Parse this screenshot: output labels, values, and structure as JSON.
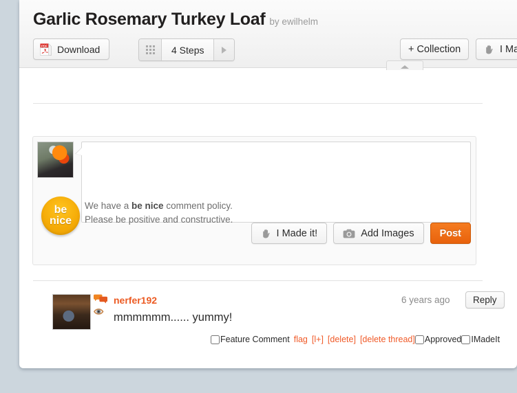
{
  "header": {
    "title": "Garlic Rosemary Turkey Loaf",
    "byline": "by ewilhelm",
    "download_label": "Download",
    "download_icon": "pdf-icon",
    "steps_label": "4 Steps",
    "steps_icon": "grid-icon",
    "steps_next_icon": "play-triangle-icon",
    "collection_label": "+ Collection",
    "made_it_label": "I Made it",
    "made_it_icon": "hand-icon",
    "collapse_tab_icon": "chevron-up-icon"
  },
  "comment_form": {
    "avatar_name": "user-avatar",
    "textarea_value": "",
    "textarea_placeholder": "",
    "benice": {
      "line1": "be",
      "line2": "nice",
      "policy_prefix": "We have a ",
      "policy_bold": "be nice",
      "policy_suffix": " comment policy.",
      "policy_line2": "Please be positive and constructive."
    },
    "made_it_label": "I Made it!",
    "made_it_icon": "hand-icon",
    "add_images_label": "Add Images",
    "add_images_icon": "camera-icon",
    "post_label": "Post"
  },
  "comment": {
    "author": "nerfer192",
    "body": "mmmmmm...... yummy!",
    "time": "6 years ago",
    "reply_label": "Reply",
    "speech_icon": "speech-bubble-icon",
    "eye_icon": "eye-icon",
    "avatar_name": "commenter-avatar",
    "moderation": {
      "feature_label": "Feature Comment",
      "flag_label": "flag",
      "plus_label": "[l+]",
      "delete_label": "[delete]",
      "delete_thread_label": "[delete thread]",
      "approved_label": "Approved",
      "imadeit_label": "IMadeIt",
      "feature_checked": false,
      "approved_checked": false,
      "imadeit_checked": false
    }
  },
  "colors": {
    "page_background": "#ccd6dd",
    "card_background": "#ffffff",
    "accent_orange": "#ec5b23",
    "post_button": "#e8620d",
    "benice_yellow": "#f5ab07",
    "link_orange": "#f05a28",
    "muted_text": "#8b8b8b"
  }
}
